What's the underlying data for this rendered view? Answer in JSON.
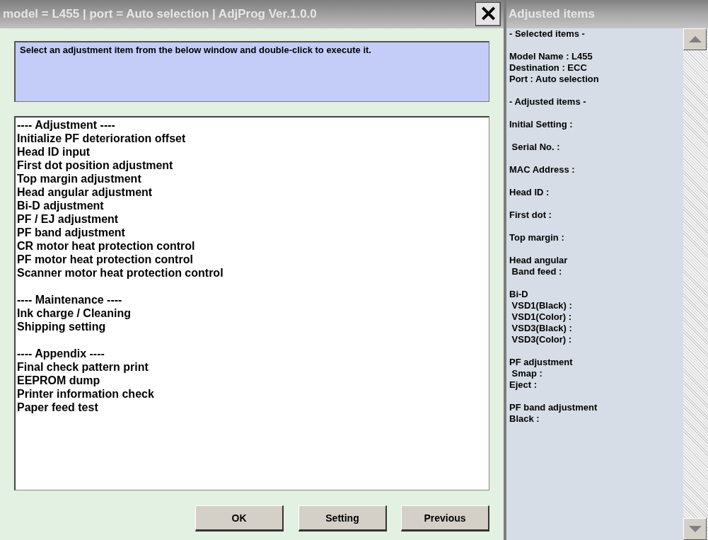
{
  "window": {
    "title": "model = L455 | port = Auto selection | AdjProg Ver.1.0.0",
    "close": "✕"
  },
  "instruction": "Select an adjustment item from the below window and double-click to execute it.",
  "item_list": [
    {
      "header": "---- Adjustment ----",
      "items": [
        "Initialize PF deterioration offset",
        "Head ID input",
        "First dot position adjustment",
        "Top margin adjustment",
        "Head angular adjustment",
        "Bi-D adjustment",
        "PF / EJ adjustment",
        "PF band adjustment",
        "CR motor heat protection control",
        "PF motor heat protection control",
        "Scanner motor heat protection control"
      ]
    },
    {
      "header": "---- Maintenance ----",
      "items": [
        "Ink charge / Cleaning",
        "Shipping setting"
      ]
    },
    {
      "header": "---- Appendix ----",
      "items": [
        "Final check pattern print",
        "EEPROM dump",
        "Printer information check",
        "Paper feed test"
      ]
    }
  ],
  "buttons": [
    "OK",
    "Setting",
    "Previous"
  ],
  "side_panel": {
    "title": "Adjusted items",
    "groups": [
      [
        "- Selected items -"
      ],
      [
        "Model Name : L455",
        "Destination : ECC",
        "Port : Auto selection"
      ],
      [
        "- Adjusted items -"
      ],
      [
        "Initial Setting :"
      ],
      [
        " Serial No. :"
      ],
      [
        "MAC Address :"
      ],
      [
        "Head ID :"
      ],
      [
        "First dot :"
      ],
      [
        "Top margin :"
      ],
      [
        "Head angular",
        " Band feed :"
      ],
      [
        "Bi-D",
        " VSD1(Black) :",
        " VSD1(Color) :",
        " VSD3(Black) :",
        " VSD3(Color) :"
      ],
      [
        "PF adjustment",
        " Smap :",
        "Eject :"
      ],
      [
        "PF band adjustment",
        "Black :"
      ]
    ]
  }
}
